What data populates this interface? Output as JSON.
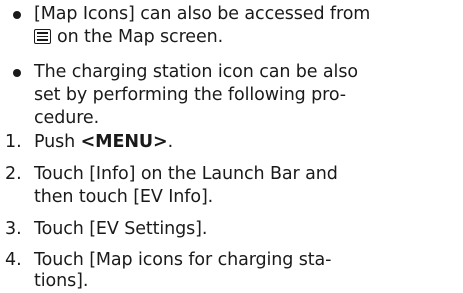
{
  "bullets": [
    {
      "lines": [
        "[Map Icons] can also be accessed from",
        "on the Map screen."
      ],
      "icon": "menu-list-icon"
    },
    {
      "lines": [
        "The charging station icon can be also",
        "set by performing the following pro-",
        "cedure."
      ]
    }
  ],
  "steps": [
    {
      "number": "1.",
      "prefix": "Push ",
      "bold": "<MENU>",
      "suffix": "."
    },
    {
      "number": "2.",
      "lines": [
        "Touch [Info] on the Launch Bar and",
        "then touch [EV Info]."
      ]
    },
    {
      "number": "3.",
      "lines": [
        "Touch [EV Settings]."
      ]
    },
    {
      "number": "4.",
      "lines": [
        "Touch [Map icons for charging sta-",
        "tions]."
      ]
    }
  ]
}
